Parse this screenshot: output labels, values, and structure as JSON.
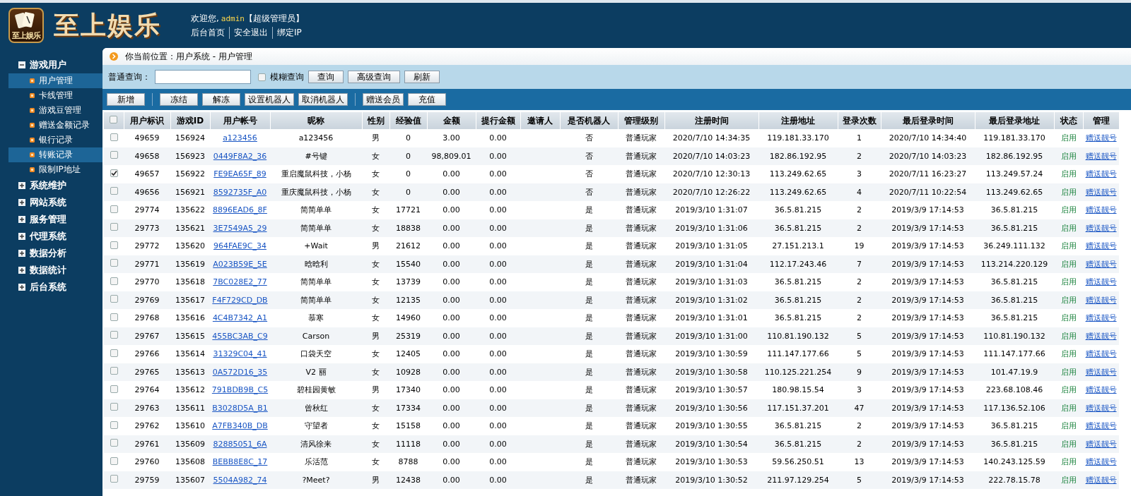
{
  "header": {
    "brand": "至上娱乐",
    "logo_text": "至上娱乐",
    "welcome": "欢迎您,",
    "user": "admin",
    "role": "【超级管理员】",
    "links": [
      "后台首页",
      "安全退出",
      "绑定IP"
    ]
  },
  "sidebar": {
    "groups": [
      {
        "label": "游戏用户",
        "expanded": true,
        "items": [
          {
            "label": "用户管理",
            "selected": true
          },
          {
            "label": "卡线管理",
            "selected": false
          },
          {
            "label": "游戏豆管理",
            "selected": false
          },
          {
            "label": "赠送金额记录",
            "selected": false
          },
          {
            "label": "银行记录",
            "selected": false
          },
          {
            "label": "转账记录",
            "selected": true
          },
          {
            "label": "限制IP地址",
            "selected": false
          }
        ]
      },
      {
        "label": "系统维护",
        "expanded": false
      },
      {
        "label": "网站系统",
        "expanded": false
      },
      {
        "label": "服务管理",
        "expanded": false
      },
      {
        "label": "代理系统",
        "expanded": false
      },
      {
        "label": "数据分析",
        "expanded": false
      },
      {
        "label": "数据统计",
        "expanded": false
      },
      {
        "label": "后台系统",
        "expanded": false
      }
    ]
  },
  "breadcrumb": "你当前位置：用户系统 - 用户管理",
  "query": {
    "label": "普通查询：",
    "fuzzy": {
      "label": "模糊查询",
      "checked": false
    },
    "buttons": [
      "查询",
      "高级查询",
      "刷新"
    ]
  },
  "toolbar": {
    "groups": [
      [
        "新增"
      ],
      [
        "冻结",
        "解冻",
        "设置机器人",
        "取消机器人"
      ],
      [
        "赠送会员",
        "充值"
      ]
    ]
  },
  "table": {
    "select_all": false,
    "columns": [
      {
        "label": "用户标识",
        "kind": "text"
      },
      {
        "label": "游戏ID",
        "kind": "text"
      },
      {
        "label": "用户帐号",
        "kind": "link"
      },
      {
        "label": "昵称",
        "kind": "text"
      },
      {
        "label": "性别",
        "kind": "text"
      },
      {
        "label": "经验值",
        "kind": "text"
      },
      {
        "label": "金额",
        "kind": "text"
      },
      {
        "label": "提行金额",
        "kind": "text"
      },
      {
        "label": "邀请人",
        "kind": "text"
      },
      {
        "label": "是否机器人",
        "kind": "text"
      },
      {
        "label": "管理级别",
        "kind": "text"
      },
      {
        "label": "注册时间",
        "kind": "text"
      },
      {
        "label": "注册地址",
        "kind": "text"
      },
      {
        "label": "登录次数",
        "kind": "text"
      },
      {
        "label": "最后登录时间",
        "kind": "text"
      },
      {
        "label": "最后登录地址",
        "kind": "text"
      },
      {
        "label": "状态",
        "kind": "status"
      },
      {
        "label": "管理",
        "kind": "link"
      }
    ],
    "rows": [
      {
        "checked": false,
        "cells": [
          "49659",
          "156924",
          "a123456",
          "a123456",
          "男",
          "0",
          "3.00",
          "0.00",
          null,
          "否",
          "普通玩家",
          "2020/7/10 14:34:35",
          "119.181.33.170",
          "1",
          "2020/7/10 14:34:40",
          "119.181.33.170",
          "启用",
          "赠送靓号"
        ]
      },
      {
        "checked": false,
        "cells": [
          "49658",
          "156923",
          "0449F8A2_36",
          "#号键",
          "女",
          "0",
          "98,809.01",
          "0.00",
          null,
          "否",
          "普通玩家",
          "2020/7/10 14:03:23",
          "182.86.192.95",
          "2",
          "2020/7/10 14:03:23",
          "182.86.192.95",
          "启用",
          "赠送靓号"
        ]
      },
      {
        "checked": true,
        "cells": [
          "49657",
          "156922",
          "FE9EA65F_89",
          "重启魔鼠科技，小杨",
          "女",
          "0",
          "0.00",
          "0.00",
          null,
          "否",
          "普通玩家",
          "2020/7/10 12:30:13",
          "113.249.62.65",
          "3",
          "2020/7/11 16:23:27",
          "113.249.57.24",
          "启用",
          "赠送靓号"
        ]
      },
      {
        "checked": false,
        "cells": [
          "49656",
          "156921",
          "8592735F_A0",
          "重庆魔鼠科技，小杨",
          "女",
          "0",
          "0.00",
          "0.00",
          null,
          "否",
          "普通玩家",
          "2020/7/10 12:26:22",
          "113.249.62.65",
          "4",
          "2020/7/11 10:22:54",
          "113.249.62.65",
          "启用",
          "赠送靓号"
        ]
      },
      {
        "checked": false,
        "cells": [
          "29774",
          "135622",
          "8896EAD6_8F",
          "简简单单",
          "女",
          "17721",
          "0.00",
          "0.00",
          null,
          "是",
          "普通玩家",
          "2019/3/10 1:31:07",
          "36.5.81.215",
          "2",
          "2019/3/9 17:14:53",
          "36.5.81.215",
          "启用",
          "赠送靓号"
        ]
      },
      {
        "checked": false,
        "cells": [
          "29773",
          "135621",
          "3E7549A5_29",
          "简简单单",
          "女",
          "18838",
          "0.00",
          "0.00",
          null,
          "是",
          "普通玩家",
          "2019/3/10 1:31:06",
          "36.5.81.215",
          "2",
          "2019/3/9 17:14:53",
          "36.5.81.215",
          "启用",
          "赠送靓号"
        ]
      },
      {
        "checked": false,
        "cells": [
          "29772",
          "135620",
          "964FAE9C_34",
          "+Wait",
          "男",
          "21612",
          "0.00",
          "0.00",
          null,
          "是",
          "普通玩家",
          "2019/3/10 1:31:05",
          "27.151.213.1",
          "19",
          "2019/3/9 17:14:53",
          "36.249.111.132",
          "启用",
          "赠送靓号"
        ]
      },
      {
        "checked": false,
        "cells": [
          "29771",
          "135619",
          "A023B59E_5E",
          "晗晗利",
          "女",
          "15540",
          "0.00",
          "0.00",
          null,
          "是",
          "普通玩家",
          "2019/3/10 1:31:04",
          "112.17.243.46",
          "7",
          "2019/3/9 17:14:53",
          "113.214.220.129",
          "启用",
          "赠送靓号"
        ]
      },
      {
        "checked": false,
        "cells": [
          "29770",
          "135618",
          "7BC028E2_77",
          "简简单单",
          "女",
          "13739",
          "0.00",
          "0.00",
          null,
          "是",
          "普通玩家",
          "2019/3/10 1:31:03",
          "36.5.81.215",
          "2",
          "2019/3/9 17:14:53",
          "36.5.81.215",
          "启用",
          "赠送靓号"
        ]
      },
      {
        "checked": false,
        "cells": [
          "29769",
          "135617",
          "F4F729CD_DB",
          "简简单单",
          "女",
          "12135",
          "0.00",
          "0.00",
          null,
          "是",
          "普通玩家",
          "2019/3/10 1:31:02",
          "36.5.81.215",
          "2",
          "2019/3/9 17:14:53",
          "36.5.81.215",
          "启用",
          "赠送靓号"
        ]
      },
      {
        "checked": false,
        "cells": [
          "29768",
          "135616",
          "4C4B7342_A1",
          "慕寒",
          "女",
          "14960",
          "0.00",
          "0.00",
          null,
          "是",
          "普通玩家",
          "2019/3/10 1:31:01",
          "36.5.81.215",
          "2",
          "2019/3/9 17:14:53",
          "36.5.81.215",
          "启用",
          "赠送靓号"
        ]
      },
      {
        "checked": false,
        "cells": [
          "29767",
          "135615",
          "455BC3AB_C9",
          "Carson",
          "男",
          "25319",
          "0.00",
          "0.00",
          null,
          "是",
          "普通玩家",
          "2019/3/10 1:31:00",
          "110.81.190.132",
          "5",
          "2019/3/9 17:14:53",
          "110.81.190.132",
          "启用",
          "赠送靓号"
        ]
      },
      {
        "checked": false,
        "cells": [
          "29766",
          "135614",
          "31329C04_41",
          "口袋天空",
          "女",
          "12405",
          "0.00",
          "0.00",
          null,
          "是",
          "普通玩家",
          "2019/3/10 1:30:59",
          "111.147.177.66",
          "5",
          "2019/3/9 17:14:53",
          "111.147.177.66",
          "启用",
          "赠送靓号"
        ]
      },
      {
        "checked": false,
        "cells": [
          "29765",
          "135613",
          "0A572D16_35",
          "V2 丽",
          "女",
          "10928",
          "0.00",
          "0.00",
          null,
          "是",
          "普通玩家",
          "2019/3/10 1:30:58",
          "110.125.221.254",
          "9",
          "2019/3/9 17:14:53",
          "101.47.19.9",
          "启用",
          "赠送靓号"
        ]
      },
      {
        "checked": false,
        "cells": [
          "29764",
          "135612",
          "791BDB9B_C5",
          "碧桂园黄敏",
          "男",
          "17340",
          "0.00",
          "0.00",
          null,
          "是",
          "普通玩家",
          "2019/3/10 1:30:57",
          "180.98.15.54",
          "3",
          "2019/3/9 17:14:53",
          "223.68.108.46",
          "启用",
          "赠送靓号"
        ]
      },
      {
        "checked": false,
        "cells": [
          "29763",
          "135611",
          "B3028D5A_B1",
          "曾秋红",
          "女",
          "17334",
          "0.00",
          "0.00",
          null,
          "是",
          "普通玩家",
          "2019/3/10 1:30:56",
          "117.151.37.201",
          "47",
          "2019/3/9 17:14:53",
          "117.136.52.106",
          "启用",
          "赠送靓号"
        ]
      },
      {
        "checked": false,
        "cells": [
          "29762",
          "135610",
          "A7FB340B_DB",
          "守望者",
          "女",
          "15158",
          "0.00",
          "0.00",
          null,
          "是",
          "普通玩家",
          "2019/3/10 1:30:55",
          "36.5.81.215",
          "2",
          "2019/3/9 17:14:53",
          "36.5.81.215",
          "启用",
          "赠送靓号"
        ]
      },
      {
        "checked": false,
        "cells": [
          "29761",
          "135609",
          "82885051_6A",
          "清风徐来",
          "女",
          "11118",
          "0.00",
          "0.00",
          null,
          "是",
          "普通玩家",
          "2019/3/10 1:30:54",
          "36.5.81.215",
          "2",
          "2019/3/9 17:14:53",
          "36.5.81.215",
          "启用",
          "赠送靓号"
        ]
      },
      {
        "checked": false,
        "cells": [
          "29760",
          "135608",
          "BEBB8E8C_17",
          "乐活范",
          "女",
          "8788",
          "0.00",
          "0.00",
          null,
          "是",
          "普通玩家",
          "2019/3/10 1:30:53",
          "59.56.250.51",
          "13",
          "2019/3/9 17:14:53",
          "140.243.125.59",
          "启用",
          "赠送靓号"
        ]
      },
      {
        "checked": false,
        "cells": [
          "29759",
          "135607",
          "5504A982_74",
          "?Meet?",
          "男",
          "12438",
          "0.00",
          "0.00",
          null,
          "是",
          "普通玩家",
          "2019/3/10 1:30:52",
          "211.97.129.254",
          "5",
          "2019/3/9 17:14:53",
          "222.78.15.78",
          "启用",
          "赠送靓号"
        ]
      }
    ]
  }
}
